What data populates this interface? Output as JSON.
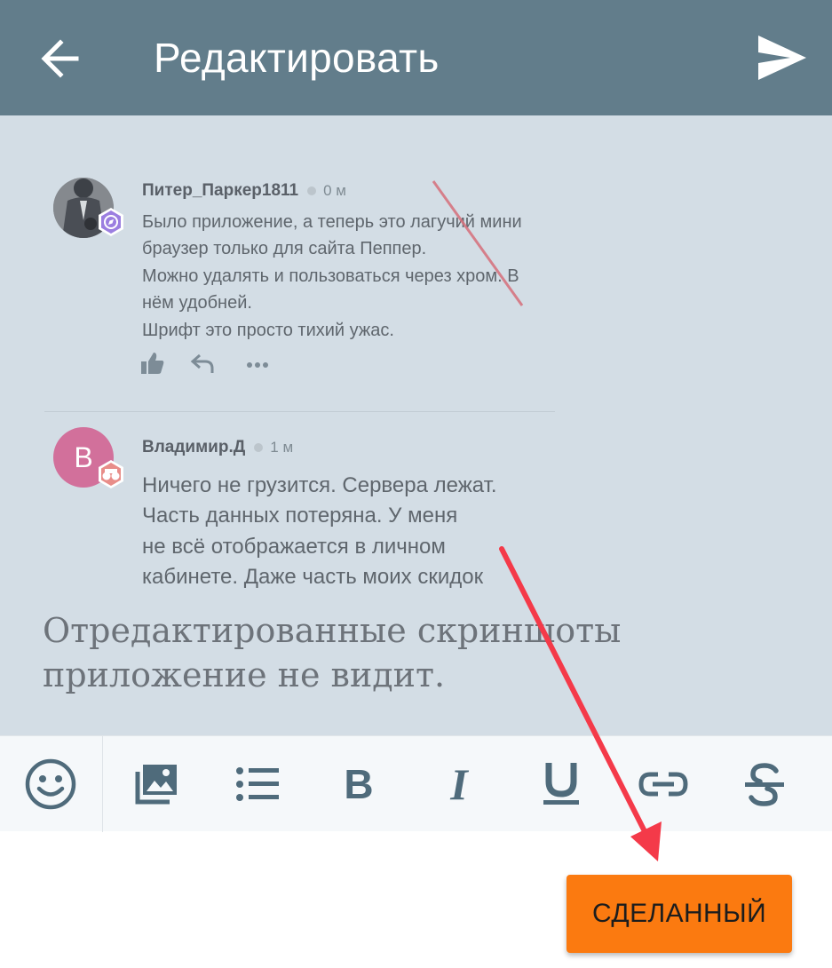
{
  "header": {
    "title": "Редактировать",
    "back_icon": "arrow-left-icon",
    "send_icon": "send-icon",
    "background": "#627d8b"
  },
  "attachment": {
    "comments": [
      {
        "author": "Питер_Паркер1811",
        "time": "0 м",
        "lines": [
          "Было приложение, а теперь это лагучий мини",
          "браузер только для сайта Пеппер.",
          "Можно удалять и пользоваться через хром. В",
          "нём удобней.",
          "Шрифт это просто тихий ужас."
        ],
        "actions": [
          "like-icon",
          "reply-icon",
          "more-icon"
        ]
      },
      {
        "author": "Владимир.Д",
        "avatar_letter": "В",
        "time": "1 м",
        "lines": [
          "Ничего не грузится. Сервера лежат.",
          "Часть данных потеряна. У меня",
          "не всё отображается в личном",
          "кабинете. Даже часть моих скидок"
        ]
      }
    ]
  },
  "editor": {
    "text": "Отредактированные скриншоты приложение не видит."
  },
  "toolbar": {
    "items": [
      "emoji-icon",
      "image-icon",
      "bulleted-list-icon",
      "bold-icon",
      "italic-icon",
      "underline-icon",
      "link-icon",
      "strikethrough-icon"
    ],
    "bold_glyph": "B",
    "italic_glyph": "I",
    "underline_glyph": "U",
    "strike_glyph": "S"
  },
  "done_button": {
    "label": "СДЕЛАННЫЙ",
    "color": "#fb7a10"
  },
  "annotation_color": "#f43a49"
}
